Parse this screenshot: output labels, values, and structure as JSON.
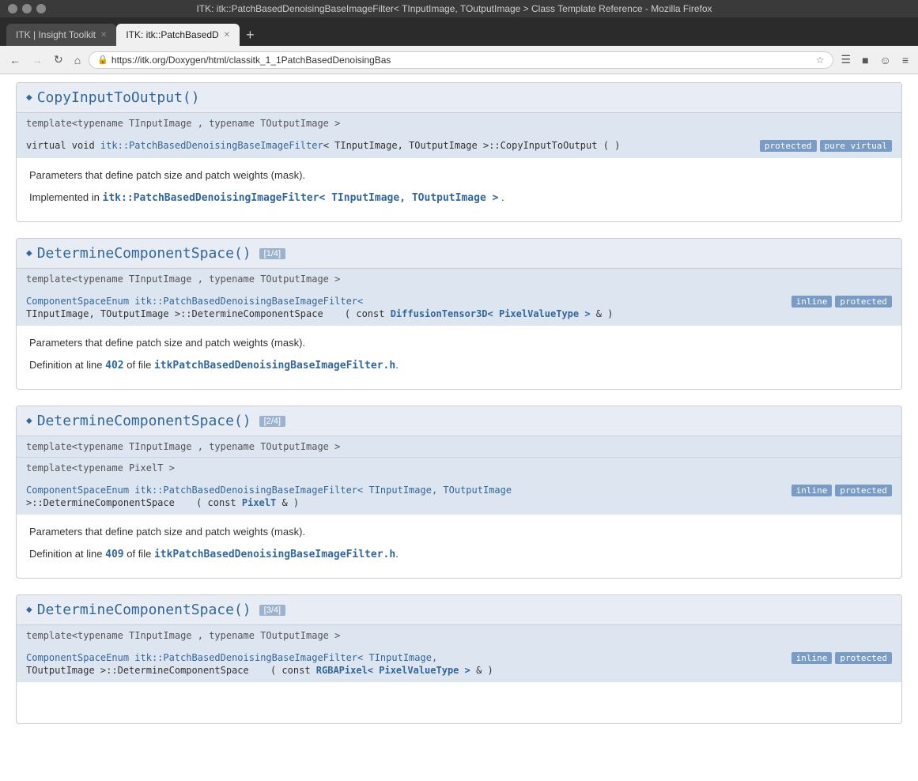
{
  "window": {
    "title": "ITK: itk::PatchBasedDenoisingBaseImageFilter< TInputImage, TOutputImage > Class Template Reference - Mozilla Firefox",
    "tab1_label": "ITK | Insight Toolkit",
    "tab2_label": "ITK: itk::PatchBasedD",
    "url": "https://itk.org/Doxygen/html/classitk_1_1PatchBasedDenoisingBas"
  },
  "badges": {
    "protected": "protected",
    "pure_virtual": "pure virtual",
    "inline": "inline"
  },
  "sections": [
    {
      "id": "section1",
      "method_name": "CopyInputToOutput()",
      "tag": null,
      "templates": [
        "template<typename TInputImage , typename TOutputImage >"
      ],
      "signature_left": "virtual void itk::PatchBasedDenoisingBaseImageFilter< TInputImage, TOutputImage >::CopyInputToOutput ( )",
      "signature_link_text": "itk::PatchBasedDenoisingBaseImageFilter",
      "signature_link_after": "< TInputImage, TOutputImage >::CopyInputToOutput ( )",
      "signature_prefix": "virtual void ",
      "badges": [
        "protected",
        "pure_virtual"
      ],
      "body_lines": [
        "Parameters that define patch size and patch weights (mask).",
        ""
      ],
      "implemented_in": true,
      "implemented_text": "Implemented in",
      "implemented_link": "itk::PatchBasedDenoisingImageFilter< TInputImage, TOutputImage >",
      "implemented_suffix": ".",
      "def_line": null
    },
    {
      "id": "section2",
      "method_name": "DetermineComponentSpace()",
      "tag": "[1/4]",
      "templates": [
        "template<typename TInputImage , typename TOutputImage >"
      ],
      "signature_line1": "ComponentSpaceEnum itk::PatchBasedDenoisingBaseImageFilter<",
      "signature_line2": "TInputImage, TOutputImage >::DetermineComponentSpace",
      "signature_link_text": "itk::PatchBasedDenoisingBaseImageFilter",
      "signature_right_part": "( const DiffusionTensor3D< PixelValueType > & )",
      "signature_prefix2": "ComponentSpaceEnum ",
      "badges": [
        "inline",
        "protected"
      ],
      "body_lines": [
        "Parameters that define patch size and patch weights (mask).",
        ""
      ],
      "def_text": "Definition at line",
      "def_line_number": "402",
      "def_file_text": "of file",
      "def_file": "itkPatchBasedDenoisingBaseImageFilter.h",
      "def_suffix": ".",
      "implemented_in": false
    },
    {
      "id": "section3",
      "method_name": "DetermineComponentSpace()",
      "tag": "[2/4]",
      "templates": [
        "template<typename TInputImage , typename TOutputImage >",
        "template<typename PixelT >"
      ],
      "signature_line1": "ComponentSpaceEnum itk::PatchBasedDenoisingBaseImageFilter< TInputImage, TOutputImage",
      "signature_line2": ">::DetermineComponentSpace",
      "signature_right_part": "( const PixelT & )",
      "badges": [
        "inline",
        "protected"
      ],
      "body_lines": [
        "Parameters that define patch size and patch weights (mask).",
        ""
      ],
      "def_text": "Definition at line",
      "def_line_number": "409",
      "def_file_text": "of file",
      "def_file": "itkPatchBasedDenoisingBaseImageFilter.h",
      "def_suffix": ".",
      "implemented_in": false
    },
    {
      "id": "section4",
      "method_name": "DetermineComponentSpace()",
      "tag": "[3/4]",
      "templates": [
        "template<typename TInputImage , typename TOutputImage >"
      ],
      "signature_line1": "ComponentSpaceEnum itk::PatchBasedDenoisingBaseImageFilter< TInputImage,",
      "signature_line2": "TOutputImage >::DetermineComponentSpace",
      "signature_right_part": "( const RGBAPixel< PixelValueType > & )",
      "badges": [
        "inline",
        "protected"
      ],
      "body_lines": [
        ""
      ],
      "def_text": null,
      "implemented_in": false
    }
  ]
}
